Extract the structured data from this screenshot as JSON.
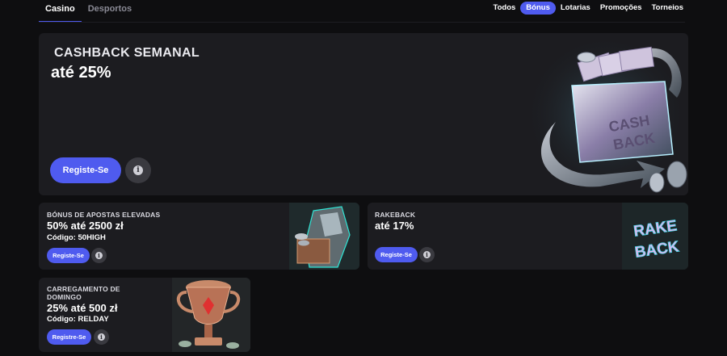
{
  "nav": {
    "tabs": [
      {
        "label": "Casino",
        "active": true
      },
      {
        "label": "Desportos",
        "active": false
      }
    ],
    "filters": [
      {
        "label": "Todos",
        "active": false
      },
      {
        "label": "Bónus",
        "active": true
      },
      {
        "label": "Lotarias",
        "active": false
      },
      {
        "label": "Promoções",
        "active": false
      },
      {
        "label": "Torneios",
        "active": false
      }
    ]
  },
  "hero": {
    "subtitle": "CASHBACK SEMANAL",
    "title": "até 25%",
    "button_label": "Registe-Se",
    "info_icon": "info-icon",
    "art_text_1": "CASH",
    "art_text_2": "BACK"
  },
  "cards": [
    {
      "subtitle": "BÓNUS DE APOSTAS ELEVADAS",
      "title": "50% até 2500 zł",
      "code": "Código: 50HIGH",
      "button_label": "Registe-Se"
    },
    {
      "subtitle": "RAKEBACK",
      "title": "até 17%",
      "button_label": "Registe-Se",
      "art_text_1": "RAKE",
      "art_text_2": "BACK"
    },
    {
      "subtitle_line1": "CARREGAMENTO DE",
      "subtitle_line2": "DOMINGO",
      "title": "25% até 500 zł",
      "code": "Código: RELDAY",
      "button_label": "Registre-Se"
    }
  ],
  "colors": {
    "background": "#0e0e10",
    "card": "#1c1c20",
    "accent": "#4f5bef"
  }
}
